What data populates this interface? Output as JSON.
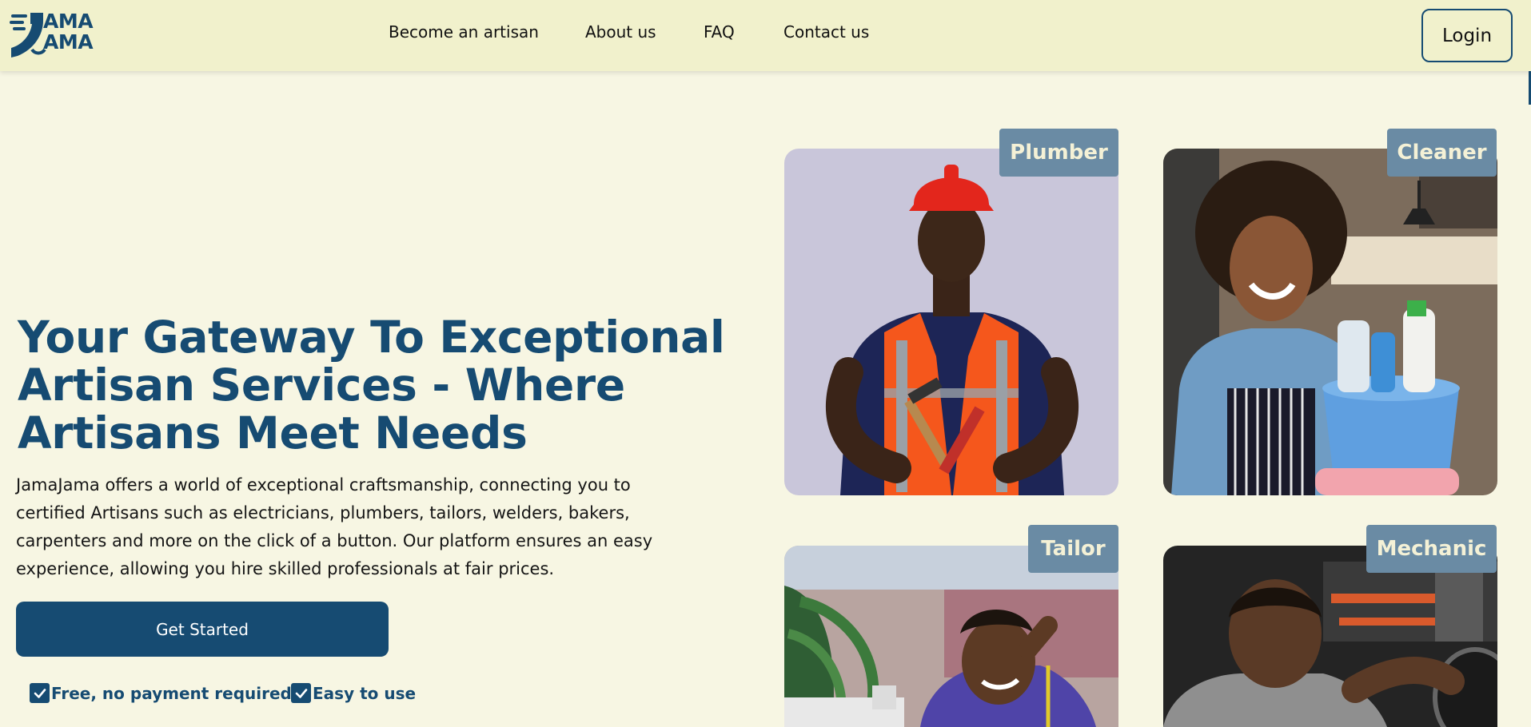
{
  "header": {
    "logo_line1": "AMA",
    "logo_line2": "AMA",
    "nav": [
      {
        "label": "Become an artisan"
      },
      {
        "label": "About us"
      },
      {
        "label": "FAQ"
      },
      {
        "label": "Contact us"
      }
    ],
    "login_label": "Login"
  },
  "hero": {
    "title": "Your Gateway To Exceptional Artisan Services - Where Artisans Meet Needs",
    "description": "JamaJama offers a world of exceptional craftsmanship, connecting you to certified Artisans such as electricians, plumbers, tailors, welders, bakers, carpenters and more on the click of a button. Our platform ensures an easy experience, allowing you hire skilled professionals at fair prices.",
    "cta_label": "Get Started",
    "checks": [
      {
        "label": "Free, no payment required!"
      },
      {
        "label": "Easy to use"
      }
    ]
  },
  "cards": [
    {
      "tag": "Plumber"
    },
    {
      "tag": "Cleaner"
    },
    {
      "tag": "Tailor"
    },
    {
      "tag": "Mechanic"
    }
  ],
  "colors": {
    "brand": "#164b72",
    "background": "#f7f6e3",
    "header_bg": "#f1f1cc",
    "tag_bg": "#6a8ba4"
  }
}
